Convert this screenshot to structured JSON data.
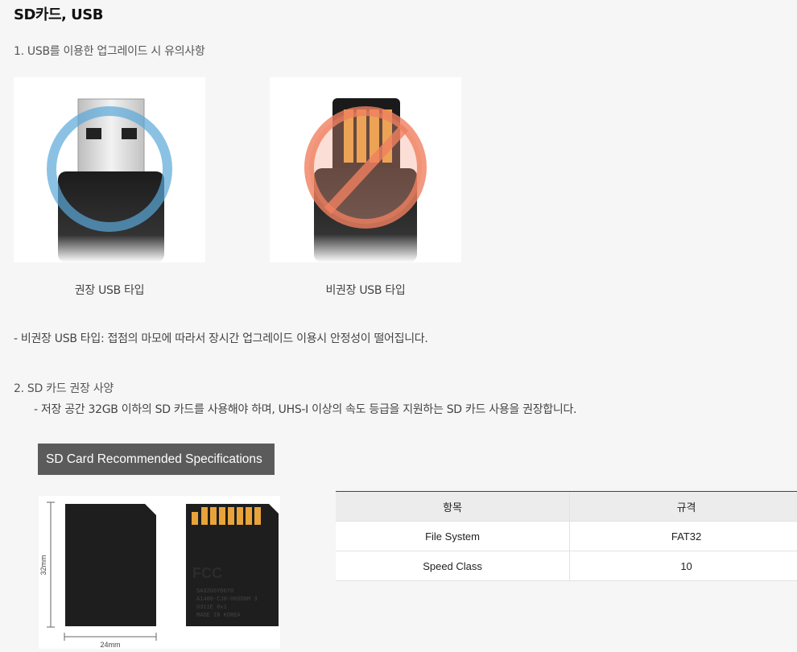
{
  "title": "SD카드, USB",
  "section1": {
    "heading": "1. USB를 이용한 업그레이드 시 유의사항",
    "images": [
      {
        "caption": "권장 USB 타입",
        "icon": "recommended-usb-icon"
      },
      {
        "caption": "비권장 USB 타입",
        "icon": "not-recommended-usb-icon"
      }
    ],
    "note": "- 비권장 USB 타입: 접점의 마모에 따라서 장시간 업그레이드 이용시 안정성이 떨어집니다."
  },
  "section2": {
    "heading": "2. SD 카드 권장 사양",
    "desc": "- 저장 공간 32GB 이하의 SD 카드를 사용해야 하며, UHS-I 이상의 속도 등급을 지원하는 SD 카드 사용을 권장합니다.",
    "badge": "SD Card Recommended Specifications",
    "sd_image": {
      "height_label": "32mm",
      "width_label": "24mm",
      "fcc_text": "FCC",
      "card_lines": [
        "SA32G6Y0070",
        "A1400-CJ0-06SDNM 3",
        "0311E 0x1",
        "MADE IN KOREA"
      ]
    },
    "table": {
      "headers": [
        "항목",
        "규격"
      ],
      "rows": [
        [
          "File System",
          "FAT32"
        ],
        [
          "Speed Class",
          "10"
        ]
      ]
    }
  },
  "colors": {
    "badge_bg": "#5b5b5b",
    "ok_ring": "#5aa8d8",
    "no_ring": "#f08060",
    "contact_gold": "#e8a33a"
  }
}
